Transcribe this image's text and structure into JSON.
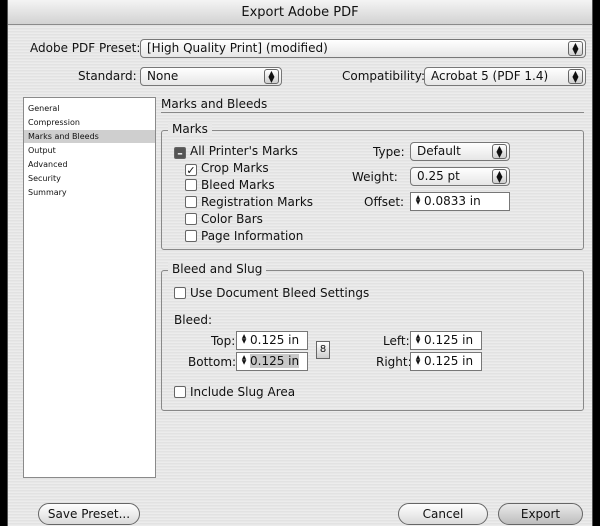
{
  "window": {
    "title": "Export Adobe PDF"
  },
  "preset": {
    "label": "Adobe PDF Preset:",
    "value": "[High Quality Print] (modified)"
  },
  "standard": {
    "label": "Standard:",
    "value": "None"
  },
  "compatibility": {
    "label": "Compatibility:",
    "value": "Acrobat 5 (PDF 1.4)"
  },
  "sidebar": {
    "items": [
      {
        "label": "General",
        "selected": false
      },
      {
        "label": "Compression",
        "selected": false
      },
      {
        "label": "Marks and Bleeds",
        "selected": true
      },
      {
        "label": "Output",
        "selected": false
      },
      {
        "label": "Advanced",
        "selected": false
      },
      {
        "label": "Security",
        "selected": false
      },
      {
        "label": "Summary",
        "selected": false
      }
    ]
  },
  "main": {
    "title": "Marks and Bleeds"
  },
  "marks": {
    "title": "Marks",
    "all_printers_marks": "All Printer's Marks",
    "crop_marks": "Crop Marks",
    "bleed_marks": "Bleed Marks",
    "registration_marks": "Registration Marks",
    "color_bars": "Color Bars",
    "page_information": "Page Information",
    "type_label": "Type:",
    "type_value": "Default",
    "weight_label": "Weight:",
    "weight_value": "0.25 pt",
    "offset_label": "Offset:",
    "offset_value": "0.0833 in"
  },
  "bleed": {
    "title": "Bleed and Slug",
    "use_document": "Use Document Bleed Settings",
    "bleed_label": "Bleed:",
    "top_label": "Top:",
    "top_value": "0.125 in",
    "bottom_label": "Bottom:",
    "bottom_value": "0.125 in",
    "left_label": "Left:",
    "left_value": "0.125 in",
    "right_label": "Right:",
    "right_value": "0.125 in",
    "include_slug": "Include Slug Area"
  },
  "buttons": {
    "save_preset": "Save Preset...",
    "cancel": "Cancel",
    "export": "Export"
  }
}
